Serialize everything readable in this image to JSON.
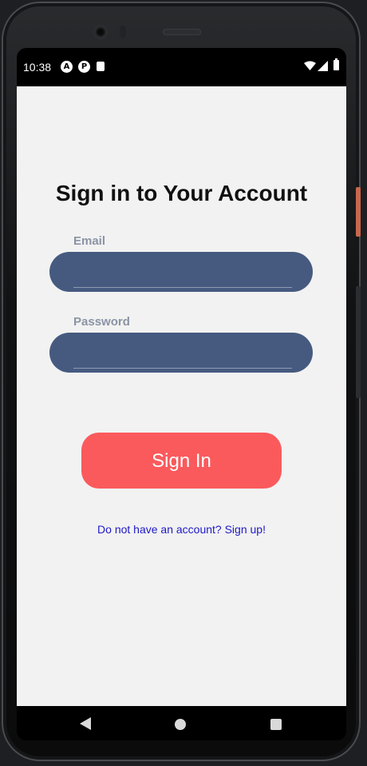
{
  "status_bar": {
    "time": "10:38",
    "notification_icons": [
      "autofill-icon",
      "app-icon",
      "sd-card-icon"
    ],
    "notif_letter_1": "A",
    "notif_letter_2": "P",
    "system_icons": [
      "wifi-icon",
      "signal-icon",
      "battery-icon"
    ]
  },
  "signin": {
    "title": "Sign in to Your Account",
    "email": {
      "label": "Email",
      "value": "",
      "placeholder": ""
    },
    "password": {
      "label": "Password",
      "value": "",
      "placeholder": ""
    },
    "submit_label": "Sign In",
    "signup_link": "Do not have an account? Sign up!"
  },
  "colors": {
    "background": "#f2f2f2",
    "input_fill": "#465a80",
    "label": "#8b93a5",
    "primary_button": "#fa5a5c",
    "link": "#1f19c7"
  },
  "navigation_bar": {
    "buttons": [
      "back-icon",
      "home-icon",
      "recents-icon"
    ]
  }
}
